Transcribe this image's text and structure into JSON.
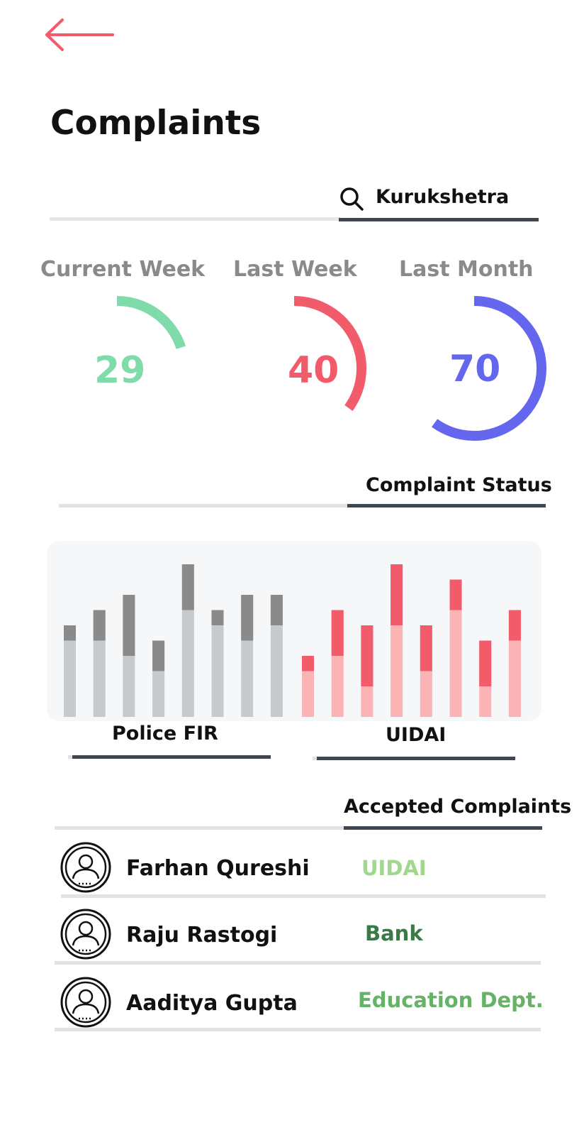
{
  "header": {
    "title": "Complaints",
    "back_icon": "arrow-left-icon"
  },
  "search": {
    "value": "Kurukshetra",
    "icon": "search-icon"
  },
  "periods": [
    {
      "label": "Current Week",
      "value": "29",
      "color": "#7fdcaa",
      "fraction": 0.2
    },
    {
      "label": "Last Week",
      "value": "40",
      "color": "#f25c6a",
      "fraction": 0.35
    },
    {
      "label": "Last Month",
      "value": "70",
      "color": "#6467ee",
      "fraction": 0.6
    }
  ],
  "complaint_status": {
    "title": "Complaint Status"
  },
  "tabs": {
    "left": "Police FIR",
    "right": "UIDAI"
  },
  "chart_data": {
    "type": "bar",
    "groups": [
      {
        "name": "Police FIR",
        "colors": {
          "base": "#c6c9cd",
          "top": "#8a8a8a"
        },
        "values": [
          6,
          7,
          8,
          5,
          10,
          7,
          8,
          8
        ],
        "highlight": [
          1,
          2,
          4,
          2,
          3,
          1,
          3,
          2
        ]
      },
      {
        "name": "UIDAI",
        "colors": {
          "base": "#fbb3b5",
          "top": "#f25c6a"
        },
        "values": [
          4,
          7,
          6,
          10,
          6,
          9,
          5,
          7
        ],
        "highlight": [
          1,
          3,
          4,
          4,
          3,
          2,
          3,
          2
        ]
      }
    ]
  },
  "accepted": {
    "title": "Accepted Complaints",
    "items": [
      {
        "name": "Farhan Qureshi",
        "dept": "UIDAI",
        "dept_color": "#9fd88e",
        "avatar_icon": "user-avatar-icon"
      },
      {
        "name": "Raju Rastogi",
        "dept": "Bank",
        "dept_color": "#3a7a46",
        "avatar_icon": "user-avatar-icon"
      },
      {
        "name": "Aaditya Gupta",
        "dept": "Education Dept.",
        "dept_color": "#66b266",
        "avatar_icon": "user-avatar-icon"
      }
    ]
  }
}
